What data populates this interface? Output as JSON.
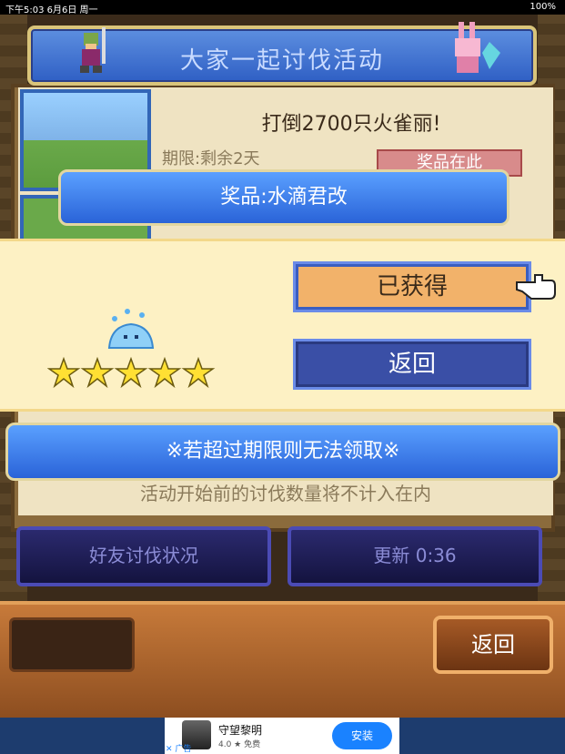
{
  "status_bar": {
    "time": "下午5:03  6月6日 周一",
    "battery": "100%"
  },
  "header": {
    "title": "大家一起讨伐活动"
  },
  "mission": {
    "text": "打倒2700只火雀丽!",
    "period": "期限:剩余2天",
    "prize_button": "奖品在此"
  },
  "bottom_note": "活动开始前的讨伐数量将不计入在内",
  "nav": {
    "friends_status": "好友讨伐状况",
    "refresh": "更新 0:36"
  },
  "footer": {
    "back": "返回"
  },
  "dialog": {
    "title": "奖品:水滴君改",
    "obtained_button": "已获得",
    "back_button": "返回",
    "rating_stars": 5,
    "notice": "※若超过期限则无法领取※"
  },
  "ad": {
    "app_name": "守望黎明",
    "rating": "4.0 ★ 免费",
    "install": "安装",
    "tag": "✕ 广告"
  },
  "colors": {
    "accent_blue": "#2a63d8",
    "obtained": "#f2b26a",
    "dialog_bg": "#fdf1c4"
  }
}
